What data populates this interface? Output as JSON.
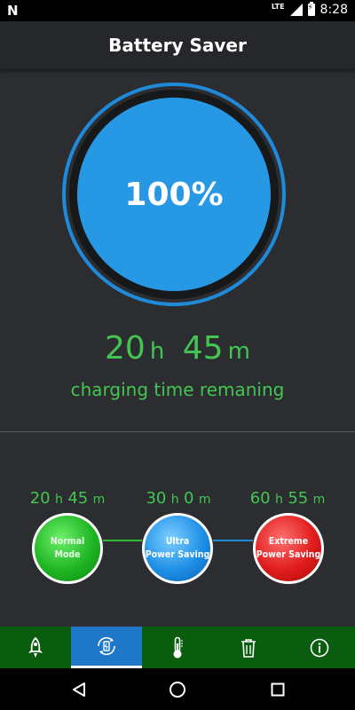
{
  "status_bar": {
    "notification_icon": "N",
    "network_label": "LTE",
    "time": "8:28"
  },
  "app_bar": {
    "title": "Battery Saver"
  },
  "gauge": {
    "percent_text": "100%",
    "charge_level": 1.0,
    "color": "#2798e4"
  },
  "charging": {
    "hours": "20",
    "hours_unit": "h",
    "minutes": "45",
    "minutes_unit": "m",
    "label": "charging time remaning",
    "color": "#43c651"
  },
  "modes": [
    {
      "hours": "20",
      "minutes": "45",
      "h_unit": "h",
      "m_unit": "m",
      "label_line1": "Normal",
      "label_line2": "Mode",
      "color": "#1fb523"
    },
    {
      "hours": "30",
      "minutes": "0",
      "h_unit": "h",
      "m_unit": "m",
      "label_line1": "Ultra",
      "label_line2": "Power Saving",
      "color": "#1e90e6"
    },
    {
      "hours": "60",
      "minutes": "55",
      "h_unit": "h",
      "m_unit": "m",
      "label_line1": "Extreme",
      "label_line2": "Power Saving",
      "color": "#e01c1c"
    }
  ],
  "tabs": [
    {
      "icon": "rocket-icon",
      "active": false
    },
    {
      "icon": "battery-refresh-icon",
      "active": true
    },
    {
      "icon": "thermometer-icon",
      "active": false
    },
    {
      "icon": "trash-icon",
      "active": false
    },
    {
      "icon": "info-icon",
      "active": false
    }
  ],
  "nav_bar": {
    "back": "back-icon",
    "home": "home-icon",
    "recents": "recents-icon"
  }
}
